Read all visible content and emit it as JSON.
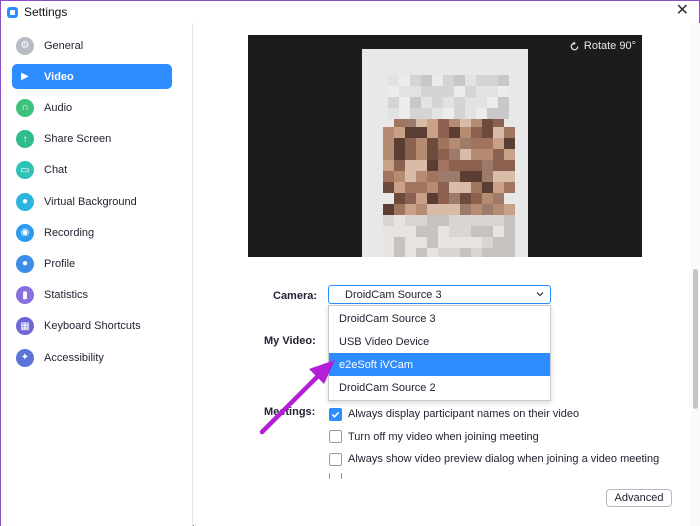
{
  "window": {
    "title": "Settings",
    "close_glyph": "✕"
  },
  "sidebar": {
    "items": [
      {
        "label": "General",
        "icon": "gear-icon",
        "color": "#b8bcc4",
        "active": false
      },
      {
        "label": "Video",
        "icon": "video-camera-icon",
        "color": "#2d8cff",
        "active": true
      },
      {
        "label": "Audio",
        "icon": "headphones-icon",
        "color": "#3fc27d",
        "active": false
      },
      {
        "label": "Share Screen",
        "icon": "share-screen-icon",
        "color": "#2ebd8a",
        "active": false
      },
      {
        "label": "Chat",
        "icon": "chat-bubble-icon",
        "color": "#2ec3b6",
        "active": false
      },
      {
        "label": "Virtual Background",
        "icon": "person-portrait-icon",
        "color": "#29b5e0",
        "active": false
      },
      {
        "label": "Recording",
        "icon": "record-icon",
        "color": "#2b9cf0",
        "active": false
      },
      {
        "label": "Profile",
        "icon": "profile-icon",
        "color": "#3c8de8",
        "active": false
      },
      {
        "label": "Statistics",
        "icon": "bar-chart-icon",
        "color": "#8a6fe0",
        "active": false
      },
      {
        "label": "Keyboard Shortcuts",
        "icon": "keyboard-icon",
        "color": "#6e66d8",
        "active": false
      },
      {
        "label": "Accessibility",
        "icon": "accessibility-icon",
        "color": "#5b74d9",
        "active": false
      }
    ]
  },
  "video": {
    "rotate_label": "Rotate 90°",
    "camera_label": "Camera:",
    "camera_value": "DroidCam Source 3",
    "camera_options": [
      {
        "label": "DroidCam Source 3",
        "selected": false
      },
      {
        "label": "USB Video Device",
        "selected": false
      },
      {
        "label": "e2eSoft iVCam",
        "selected": true
      },
      {
        "label": "DroidCam Source 2",
        "selected": false
      }
    ],
    "my_video_label": "My Video:",
    "meetings_label": "Meetings:",
    "meeting_options": [
      {
        "label": "Always display participant names on their video",
        "checked": true
      },
      {
        "label": "Turn off my video when joining meeting",
        "checked": false
      },
      {
        "label": "Always show video preview dialog when joining a video meeting",
        "checked": false
      }
    ],
    "advanced_label": "Advanced"
  },
  "colors": {
    "accent": "#2d8cff",
    "annotation_arrow": "#b21fd6",
    "window_border": "#8a4fc7"
  }
}
